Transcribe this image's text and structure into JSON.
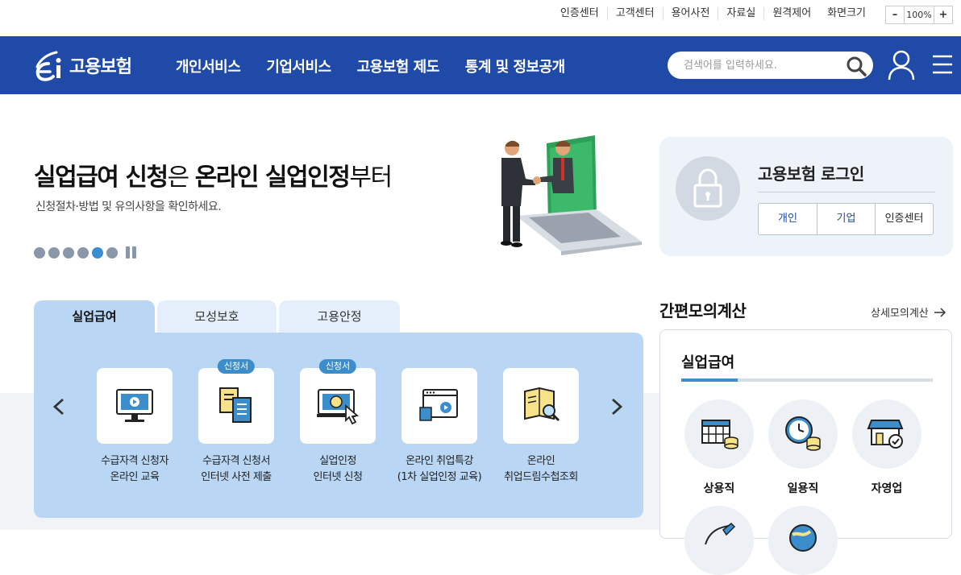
{
  "utility": {
    "links": [
      "인증센터",
      "고객센터",
      "용어사전",
      "자료실",
      "원격제어"
    ],
    "zoom_label": "화면크기",
    "zoom_minus": "–",
    "zoom_value": "100%",
    "zoom_plus": "+"
  },
  "nav": {
    "logo_text": "고용보험",
    "menu": [
      "개인서비스",
      "기업서비스",
      "고용보험 제도",
      "통계 및 정보공개"
    ],
    "search_placeholder": "검색어를 입력하세요."
  },
  "hero": {
    "title_parts": {
      "a": "실업급여 신청",
      "b": "은 ",
      "c": "온라인 실업인정",
      "d": "부터"
    },
    "subtitle": "신청절차·방법 및 유의사항을 확인하세요.",
    "slide_count": 6,
    "active_slide": 5
  },
  "login": {
    "title": "고용보험 로그인",
    "buttons": [
      "개인",
      "기업",
      "인증센터"
    ]
  },
  "tabs": [
    "실업급여",
    "모성보호",
    "고용안정"
  ],
  "services": [
    {
      "badge": "",
      "line1": "수급자격 신청자",
      "line2": "온라인 교육"
    },
    {
      "badge": "신청서",
      "line1": "수급자격 신청서",
      "line2": "인터넷 사전 제출"
    },
    {
      "badge": "신청서",
      "line1": "실업인정",
      "line2": "인터넷 신청"
    },
    {
      "badge": "",
      "line1": "온라인 취업특강",
      "line2": "(1차 실업인정 교육)"
    },
    {
      "badge": "",
      "line1": "온라인",
      "line2": "취업드림수첩조회"
    }
  ],
  "calculator": {
    "title": "간편모의계산",
    "more_link": "상세모의계산",
    "card_title": "실업급여",
    "jobs": [
      "상용직",
      "일용직",
      "자영업"
    ]
  },
  "colors": {
    "brand_blue": "#1f4aa8",
    "panel_blue": "#b9d7f5",
    "accent": "#3c8dcc"
  }
}
